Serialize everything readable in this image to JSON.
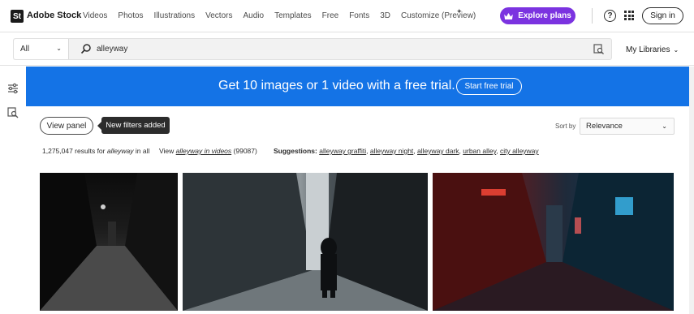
{
  "brand": {
    "logo_mark": "St",
    "name": "Adobe Stock"
  },
  "nav": {
    "items": [
      "Videos",
      "Photos",
      "Illustrations",
      "Vectors",
      "Audio",
      "Templates",
      "Free",
      "Fonts",
      "3D",
      "Customize (Preview)"
    ]
  },
  "header": {
    "explore_label": "Explore plans",
    "help_glyph": "?",
    "signin_label": "Sign in"
  },
  "search": {
    "category": "All",
    "query": "alleyway",
    "libraries_label": "My Libraries"
  },
  "banner": {
    "text": "Get 10 images or 1 video with a free trial.",
    "button": "Start free trial"
  },
  "filters": {
    "view_panel_label": "View panel",
    "tooltip": "New filters added",
    "sort_label": "Sort by",
    "sort_value": "Relevance"
  },
  "results": {
    "count_text": "1,275,047 results for",
    "query": "alleyway",
    "scope": "in all",
    "view_prefix": "View",
    "video_link": "alleyway in videos",
    "video_count": "(99087)",
    "suggestions_label": "Suggestions:",
    "suggestions": [
      "alleyway graffiti",
      "alleyway night",
      "alleyway dark",
      "urban alley",
      "city alleyway"
    ]
  },
  "icons": {
    "search": "search-icon",
    "visual_search": "image-search-icon",
    "filters": "filter-sliders-icon",
    "apps": "apps-grid-icon",
    "help": "help-icon",
    "crown": "crown-icon"
  },
  "colors": {
    "accent_purple": "#7b33e0",
    "banner_blue": "#1473e6"
  }
}
